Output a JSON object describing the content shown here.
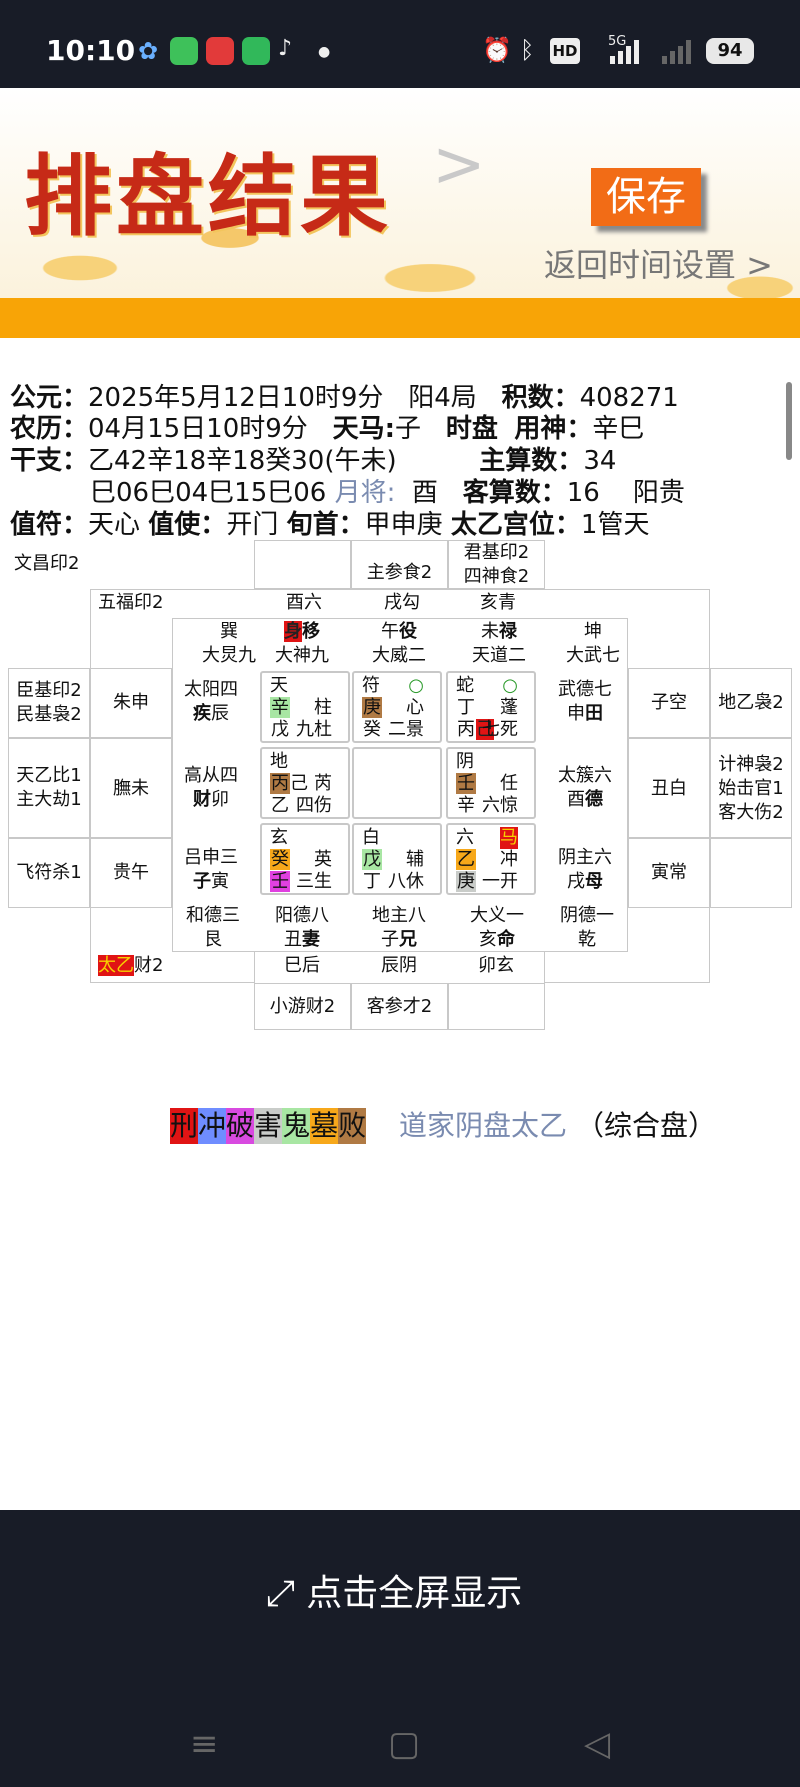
{
  "status_bar": {
    "time": "10:10",
    "hd": "HD",
    "net": "5G",
    "battery": "94"
  },
  "header": {
    "title": "排盘结果",
    "arrow": ">",
    "save_label": "保存",
    "back_label": "返回时间设置 >"
  },
  "info": {
    "l1": {
      "k1": "公元：",
      "date": "2025年5月12日10时9分",
      "ju": "阳4局",
      "k2": "积数：",
      "jishu": "408271"
    },
    "l2": {
      "k1": "农历：",
      "lunar": "04月15日10时9分",
      "k2": "天马:",
      "tianma": "子",
      "k3": "时盘",
      "k4": "用神：",
      "yongshen": "辛巳"
    },
    "l3": {
      "k1": "干支：",
      "ganzhi": "乙42辛18辛18癸30(午未)",
      "k2": "主算数：",
      "zhu": "34"
    },
    "l4": {
      "ganzhi2": "巳06巳04巳15巳06",
      "k1": "月将:",
      "yuejiang": "酉",
      "k2": "客算数：",
      "ke": "16",
      "guiren": "阳贵"
    },
    "l5": {
      "k1": "值符：",
      "zhifu": "天心",
      "k2": "值使：",
      "zhishi": "开门",
      "k3": "旬首：",
      "xunshou": "甲申庚",
      "k4": "太乙宫位：",
      "gongwei": "1管天"
    }
  },
  "grid": {
    "outer_top": [
      "",
      "主参食2",
      "君基印2",
      "四神食2"
    ],
    "wenchang": "文昌印2",
    "wufu": "五福印2",
    "branches_top": [
      "酉六",
      "戌勾",
      "亥青"
    ],
    "corner_xun": "巽",
    "corner_xun2": "大炅九",
    "corner_kun": "坤",
    "corner_kun2": "大武七",
    "top_mid": [
      {
        "a": "身",
        "b": "移",
        "c": "大神九"
      },
      {
        "a": "午",
        "b": "役",
        "c": "大威二"
      },
      {
        "a": "未",
        "b": "禄",
        "c": "天道二"
      }
    ],
    "left_outer": [
      "臣基印2",
      "民基袅2",
      "天乙比1",
      "主大劫1",
      "飞符杀1"
    ],
    "left_mid": [
      "朱申",
      "膴未",
      "贵午"
    ],
    "left_in": [
      {
        "a": "太阳四",
        "b": "疾",
        "c": "辰"
      },
      {
        "a": "高从四",
        "b": "财",
        "c": "卯"
      },
      {
        "a": "吕申三",
        "b": "子",
        "c": "寅"
      }
    ],
    "right_in": [
      {
        "a": "武德七",
        "b": "申",
        "c": "田"
      },
      {
        "a": "太簇六",
        "b": "酉",
        "c": "德"
      },
      {
        "a": "阴主六",
        "b": "戌",
        "c": "母"
      }
    ],
    "right_mid": [
      "子空",
      "丑白",
      "寅常"
    ],
    "right_outer": [
      "地乙袅2",
      "计神袅2",
      "始击官1",
      "客大伤2"
    ],
    "bottom_in": [
      {
        "a": "和德三",
        "b": "艮"
      },
      {
        "a": "阳德八",
        "b": "丑",
        "c": "妻"
      },
      {
        "a": "地主八",
        "b": "子",
        "c": "兄"
      },
      {
        "a": "大义一",
        "b": "亥",
        "c": "命"
      },
      {
        "a": "阴德一",
        "b": "乾"
      }
    ],
    "taiyi": "太乙",
    "taiyi_suffix": "财2",
    "bottom_branches": [
      "巳后",
      "辰阴",
      "卯玄"
    ],
    "outer_bottom": [
      "小游财2",
      "客参才2"
    ],
    "palaces": [
      {
        "god": "天",
        "gan1": "辛",
        "star": "柱",
        "gan2": "戊",
        "gate": "九杜"
      },
      {
        "god": "符",
        "mark": "○",
        "gan1": "庚",
        "star": "心",
        "gan2": "癸",
        "gate": "二景"
      },
      {
        "god": "蛇",
        "mark": "○",
        "gan1": "丁",
        "star": "蓬",
        "gan2": "丙",
        "hl": "己",
        "gate": "七死"
      },
      {
        "god": "地",
        "gan1": "丙",
        "gan1b": "己",
        "star": "芮",
        "gan2": "乙",
        "gate": "四伤"
      },
      {},
      {
        "god": "阴",
        "gan1": "壬",
        "star": "任",
        "gan2": "辛",
        "gate": "六惊"
      },
      {
        "god": "玄",
        "gan1": "癸",
        "star": "英",
        "gan2": "壬",
        "gate": "三生"
      },
      {
        "god": "白",
        "gan1": "戊",
        "star": "辅",
        "gan2": "丁",
        "gate": "八休"
      },
      {
        "god": "六",
        "mark": "马",
        "gan1": "乙",
        "star": "冲",
        "gan2": "庚",
        "gate": "一开"
      }
    ]
  },
  "legend": {
    "items": [
      "刑",
      "冲",
      "破",
      "害",
      "鬼",
      "墓",
      "败"
    ],
    "colors": [
      "#e01414",
      "#6f8dff",
      "#d84ae0",
      "#c9ccc9",
      "#a8e6a3",
      "#f7a81a",
      "#b07a44"
    ],
    "title": "道家阴盘太乙",
    "subtitle": "（综合盘）"
  },
  "bottom": {
    "fullscreen_label": "点击全屏显示"
  }
}
